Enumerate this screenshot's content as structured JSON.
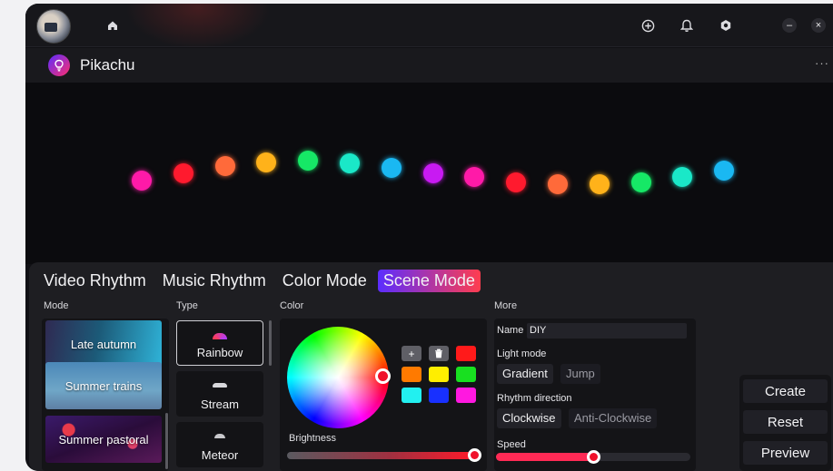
{
  "header": {
    "icons": [
      "home-icon",
      "add-circle-icon",
      "bell-icon",
      "settings-hex-icon",
      "minimize-icon",
      "close-icon"
    ],
    "minimize_glyph": "–",
    "close_glyph": "×"
  },
  "device": {
    "name": "Pikachu",
    "more_label": "···"
  },
  "preview": {
    "leds": [
      {
        "color": "#ff1aa8"
      },
      {
        "color": "#ff1a2e"
      },
      {
        "color": "#ff6a3a"
      },
      {
        "color": "#ffb21a"
      },
      {
        "color": "#16e866"
      },
      {
        "color": "#1ae8c8"
      },
      {
        "color": "#1ab8f2"
      },
      {
        "color": "#c81af2"
      },
      {
        "color": "#ff1aa8"
      },
      {
        "color": "#ff1a2e"
      },
      {
        "color": "#ff6a3a"
      },
      {
        "color": "#ffb21a"
      },
      {
        "color": "#16e866"
      },
      {
        "color": "#1ae8c8"
      },
      {
        "color": "#1ab8f2"
      }
    ]
  },
  "tabs": [
    {
      "label": "Video Rhythm",
      "active": false
    },
    {
      "label": "Music Rhythm",
      "active": false
    },
    {
      "label": "Color Mode",
      "active": false
    },
    {
      "label": "Scene Mode",
      "active": true
    }
  ],
  "sections": {
    "mode": "Mode",
    "type": "Type",
    "color": "Color",
    "more": "More"
  },
  "modes": [
    {
      "label": "Late autumn"
    },
    {
      "label": "Summer trains"
    },
    {
      "label": "Summer pastoral"
    }
  ],
  "types": [
    {
      "label": "Rainbow",
      "selected": true
    },
    {
      "label": "Stream",
      "selected": false
    },
    {
      "label": "Meteor",
      "selected": false
    }
  ],
  "color": {
    "add_glyph": "+",
    "delete_icon": "trash-icon",
    "swatches": [
      "#ff1a1a",
      "#ff7a00",
      "#ffee00",
      "#18e020",
      "#22f0f0",
      "#1830ff",
      "#ff18e0"
    ],
    "selected_color": "#f0122c",
    "brightness_label": "Brightness",
    "brightness": 1.0
  },
  "more": {
    "name_label": "Name",
    "name_value": "DIY",
    "light_mode_label": "Light mode",
    "light_modes": [
      "Gradient",
      "Jump"
    ],
    "rhythm_direction_label": "Rhythm direction",
    "directions": [
      "Clockwise",
      "Anti-Clockwise"
    ],
    "speed_label": "Speed",
    "speed": 0.5
  },
  "actions": {
    "create": "Create",
    "reset": "Reset",
    "preview": "Preview"
  }
}
